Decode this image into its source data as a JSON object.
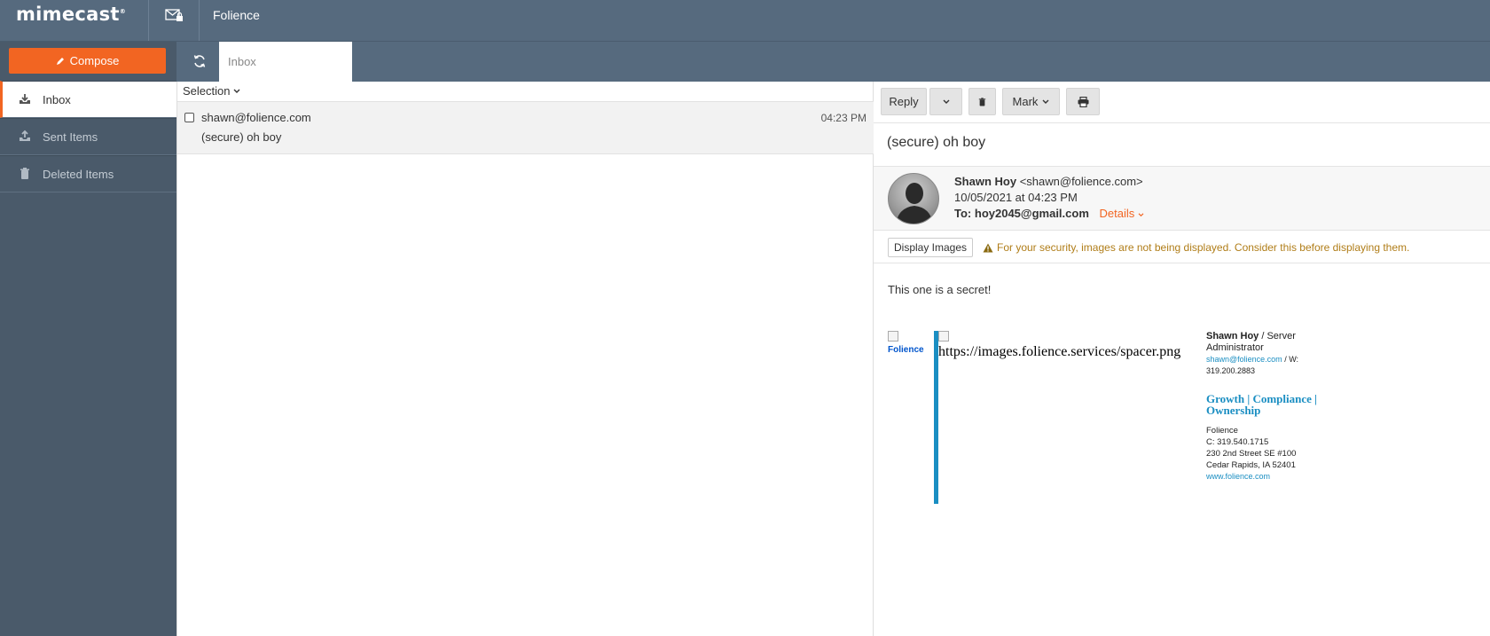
{
  "topbar": {
    "logo_text": "mimecast",
    "logo_mark": "®",
    "org_name": "Folience",
    "secure_mail_icon": "mail-lock-icon"
  },
  "sidebar": {
    "compose_label": "Compose",
    "compose_icon": "pencil-icon",
    "items": [
      {
        "label": "Inbox",
        "icon": "inbox-download-icon",
        "active": true
      },
      {
        "label": "Sent Items",
        "icon": "outbox-upload-icon",
        "active": false
      },
      {
        "label": "Deleted Items",
        "icon": "trash-icon",
        "active": false
      }
    ]
  },
  "tabs": {
    "refresh_icon": "refresh-icon",
    "active_tab": "Inbox"
  },
  "message_list": {
    "selection_label": "Selection",
    "messages": [
      {
        "from": "shawn@folience.com",
        "subject": "(secure) oh boy",
        "time": "04:23 PM"
      }
    ]
  },
  "reader": {
    "toolbar": {
      "reply_label": "Reply",
      "reply_dropdown_icon": "chevron-down-icon",
      "delete_icon": "trash-icon",
      "mark_label": "Mark",
      "print_icon": "print-icon"
    },
    "subject": "(secure) oh boy",
    "sender_name": "Shawn Hoy",
    "sender_email": "<shawn@folience.com>",
    "date": "10/05/2021 at 04:23 PM",
    "to_label": "To:",
    "to_address": "hoy2045@gmail.com",
    "details_label": "Details",
    "display_images_label": "Display Images",
    "security_notice": "For your security, images are not being displayed. Consider this before displaying them.",
    "body": "This one is a secret!",
    "signature": {
      "logo_alt": "Folience",
      "spacer_alt": "https://images.folience.services/spacer.png",
      "name": "Shawn Hoy",
      "title_sep": " / ",
      "title": "Server Administrator",
      "email": "shawn@folience.com",
      "phone_label": " / W:",
      "phone": "319.200.2883",
      "tagline": "Growth | Compliance | Ownership",
      "company": "Folience",
      "cell": "C: 319.540.1715",
      "address1": "230 2nd Street SE #100",
      "address2": "Cedar Rapids, IA 52401",
      "website": "www.folience.com"
    }
  },
  "colors": {
    "accent": "#f26522",
    "topbar": "#566a7e",
    "sidebar": "#4a5a6a",
    "signature_blue": "#1a8ec2",
    "warning": "#b07d18"
  }
}
